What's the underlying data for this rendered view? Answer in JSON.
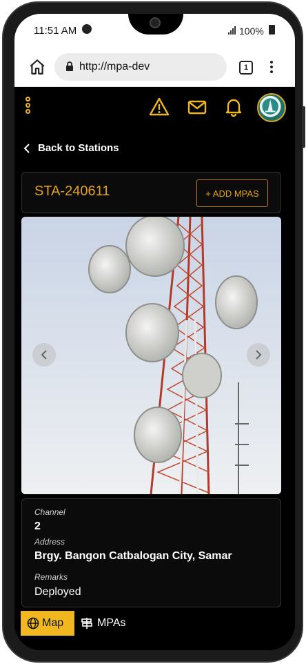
{
  "status_bar": {
    "time": "11:51 AM",
    "battery": "100%"
  },
  "browser": {
    "url": "http://mpa-dev",
    "tab_count": "1"
  },
  "nav": {
    "back_label": "Back to Stations"
  },
  "station": {
    "id": "STA-240611",
    "add_button_label": "+ ADD MPAS"
  },
  "details": {
    "channel_label": "Channel",
    "channel_value": "2",
    "address_label": "Address",
    "address_value": "Brgy. Bangon Catbalogan City, Samar",
    "remarks_label": "Remarks",
    "remarks_value": "Deployed"
  },
  "tabs": [
    {
      "label": "Map",
      "icon": "globe-icon"
    },
    {
      "label": "MPAs",
      "icon": "signpost-icon"
    }
  ],
  "colors": {
    "accent": "#f0b81e",
    "accent_text": "#e4a21b",
    "background": "#000000"
  }
}
